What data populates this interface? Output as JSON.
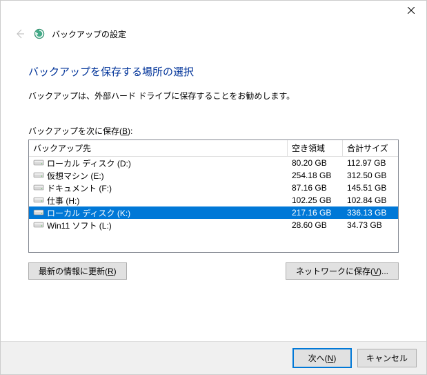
{
  "window": {
    "title": "バックアップの設定"
  },
  "content": {
    "heading": "バックアップを保存する場所の選択",
    "subtext": "バックアップは、外部ハード ドライブに保存することをお勧めします。",
    "list_label_prefix": "バックアップを次に保存(",
    "list_label_key": "B",
    "list_label_suffix": "):"
  },
  "columns": {
    "dest": "バックアップ先",
    "free": "空き領域",
    "total": "合計サイズ"
  },
  "drives": [
    {
      "name": "ローカル ディスク (D:)",
      "free": "80.20 GB",
      "total": "112.97 GB",
      "selected": false
    },
    {
      "name": "仮想マシン (E:)",
      "free": "254.18 GB",
      "total": "312.50 GB",
      "selected": false
    },
    {
      "name": "ドキュメント (F:)",
      "free": "87.16 GB",
      "total": "145.51 GB",
      "selected": false
    },
    {
      "name": "仕事 (H:)",
      "free": "102.25 GB",
      "total": "102.84 GB",
      "selected": false
    },
    {
      "name": "ローカル ディスク (K:)",
      "free": "217.16 GB",
      "total": "336.13 GB",
      "selected": true
    },
    {
      "name": "Win11 ソフト (L:)",
      "free": "28.60 GB",
      "total": "34.73 GB",
      "selected": false
    }
  ],
  "buttons": {
    "refresh_prefix": "最新の情報に更新(",
    "refresh_key": "R",
    "refresh_suffix": ")",
    "network_prefix": "ネットワークに保存(",
    "network_key": "V",
    "network_suffix": ")...",
    "next_prefix": "次へ(",
    "next_key": "N",
    "next_suffix": ")",
    "cancel": "キャンセル"
  },
  "icons": {
    "close": "close-icon",
    "back": "back-arrow-icon",
    "header": "backup-settings-icon",
    "drive": "hard-drive-icon"
  }
}
